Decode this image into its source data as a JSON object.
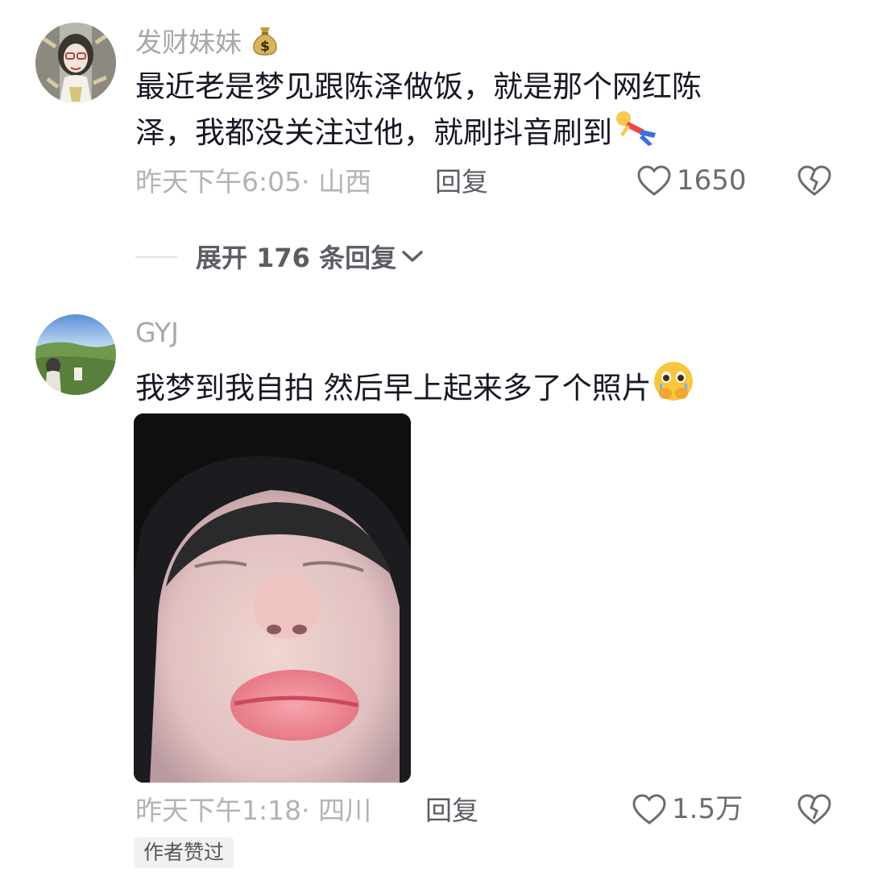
{
  "comments": [
    {
      "username": "发财妹妹",
      "username_emoji": "money-bag-icon",
      "text_line1": "最近老是梦见跟陈泽做饭，就是那个网红陈",
      "text_line2": "泽，我都没关注过他，就刷抖音刷到",
      "trailing_emoji": "fallen-person-emoji",
      "time_location": "昨天下午6:05· 山西",
      "reply_label": "回复",
      "like_count": "1650"
    },
    {
      "username": "GYJ",
      "text": "我梦到我自拍 然后早上起来多了个照片",
      "trailing_emoji": "pleading-face-emoji",
      "time_location": "昨天下午1:18· 四川",
      "reply_label": "回复",
      "like_count": "1.5万",
      "badge": "作者赞过"
    }
  ],
  "expand_replies": {
    "label": "展开 176 条回复",
    "icon": "chevron-down-icon"
  },
  "colors": {
    "text_primary": "#161823",
    "text_secondary": "#a6a6ab",
    "action_gray": "#5c5d64",
    "badge_bg": "#f1f1f2"
  }
}
